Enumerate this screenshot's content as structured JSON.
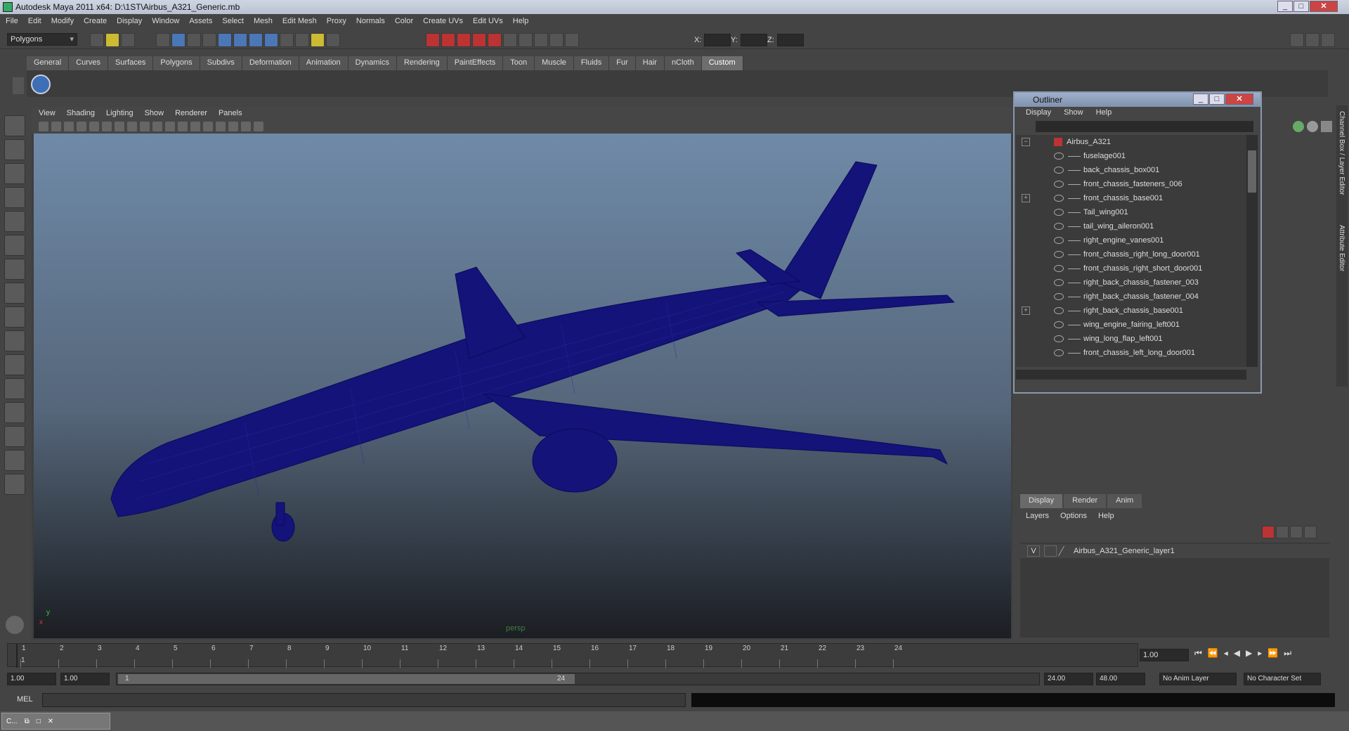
{
  "window": {
    "title": "Autodesk Maya 2011 x64: D:\\1ST\\Airbus_A321_Generic.mb"
  },
  "menubar": [
    "File",
    "Edit",
    "Modify",
    "Create",
    "Display",
    "Window",
    "Assets",
    "Select",
    "Mesh",
    "Edit Mesh",
    "Proxy",
    "Normals",
    "Color",
    "Create UVs",
    "Edit UVs",
    "Help"
  ],
  "statusline": {
    "mode": "Polygons",
    "x_label": "X:",
    "y_label": "Y:",
    "z_label": "Z:"
  },
  "shelf_tabs": [
    "General",
    "Curves",
    "Surfaces",
    "Polygons",
    "Subdivs",
    "Deformation",
    "Animation",
    "Dynamics",
    "Rendering",
    "PaintEffects",
    "Toon",
    "Muscle",
    "Fluids",
    "Fur",
    "Hair",
    "nCloth",
    "Custom"
  ],
  "shelf_active": "Custom",
  "viewport": {
    "menu": [
      "View",
      "Shading",
      "Lighting",
      "Show",
      "Renderer",
      "Panels"
    ],
    "camera_label": "persp",
    "wire_color": "#14137a"
  },
  "outliner": {
    "title": "Outliner",
    "menu": [
      "Display",
      "Show",
      "Help"
    ],
    "root": "Airbus_A321",
    "items": [
      {
        "name": "fuselage001",
        "expandable": false
      },
      {
        "name": "back_chassis_box001",
        "expandable": false
      },
      {
        "name": "front_chassis_fasteners_006",
        "expandable": false
      },
      {
        "name": "front_chassis_base001",
        "expandable": true
      },
      {
        "name": "Tail_wing001",
        "expandable": false
      },
      {
        "name": "tail_wing_aileron001",
        "expandable": false
      },
      {
        "name": "right_engine_vanes001",
        "expandable": false
      },
      {
        "name": "front_chassis_right_long_door001",
        "expandable": false
      },
      {
        "name": "front_chassis_right_short_door001",
        "expandable": false
      },
      {
        "name": "right_back_chassis_fastener_003",
        "expandable": false
      },
      {
        "name": "right_back_chassis_fastener_004",
        "expandable": false
      },
      {
        "name": "right_back_chassis_base001",
        "expandable": true
      },
      {
        "name": "wing_engine_fairing_left001",
        "expandable": false
      },
      {
        "name": "wing_long_flap_left001",
        "expandable": false
      },
      {
        "name": "front_chassis_left_long_door001",
        "expandable": false
      }
    ]
  },
  "side_tabs": [
    "Channel Box / Layer Editor",
    "Attribute Editor"
  ],
  "layer_editor": {
    "tabs": [
      "Display",
      "Render",
      "Anim"
    ],
    "active_tab": "Display",
    "menu": [
      "Layers",
      "Options",
      "Help"
    ],
    "layer": {
      "visible": "V",
      "name": "Airbus_A321_Generic_layer1"
    }
  },
  "timeline": {
    "ticks": [
      1,
      2,
      3,
      4,
      5,
      6,
      7,
      8,
      9,
      10,
      11,
      12,
      13,
      14,
      15,
      16,
      17,
      18,
      19,
      20,
      21,
      22,
      23,
      24
    ],
    "current_frame": "1.00",
    "marker": "1"
  },
  "range": {
    "start": "1.00",
    "playback_start": "1.00",
    "slider_start": "1",
    "slider_end": "24",
    "playback_end": "24.00",
    "end": "48.00",
    "anim_layer": "No Anim Layer",
    "character_set": "No Character Set"
  },
  "command_line": {
    "label": "MEL"
  },
  "taskbar": {
    "item": "C..."
  }
}
